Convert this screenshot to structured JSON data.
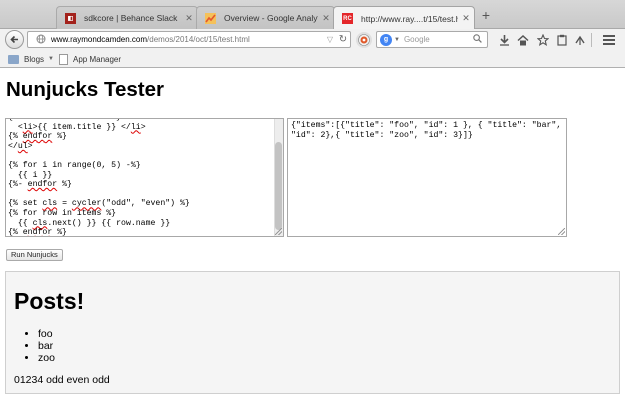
{
  "tabs": [
    {
      "label": "sdkcore | Behance Slack",
      "favicon": "behance-icon",
      "active": false
    },
    {
      "label": "Overview - Google Analytics",
      "favicon": "analytics-icon",
      "active": false
    },
    {
      "label": "http://www.ray....t/15/test.html",
      "favicon": "rc-icon",
      "favicon_text": "RC",
      "active": true
    }
  ],
  "new_tab_label": "+",
  "urlbar": {
    "url_domain": "www.raymondcamden.com",
    "url_path": "/demos/2014/oct/15/test.html"
  },
  "search": {
    "placeholder": "Google",
    "engine_icon": "g-icon"
  },
  "bookmarks": [
    {
      "label": "Blogs",
      "icon": "folder-icon",
      "has_dropdown": true
    },
    {
      "label": "App Manager",
      "icon": "page-icon",
      "has_dropdown": false
    }
  ],
  "page": {
    "title": "Nunjucks Tester",
    "template_code": "{% for item in items %}\n  <li>{{ item.title }} </li>\n{% endfor %}\n</ul>\n\n{% for i in range(0, 5) -%}\n  {{ i }}\n{%- endfor %}\n\n{% set cls = cycler(\"odd\", \"even\") %}\n{% for row in items %}\n  {{ cls.next() }} {{ row.name }}\n{% endfor %}",
    "json_data": "{\"items\":[{\"title\": \"foo\", \"id\": 1 }, { \"title\": \"bar\", \"id\": 2},{ \"title\": \"zoo\", \"id\": 3}]}",
    "run_button": "Run Nunjucks"
  },
  "result": {
    "heading": "Posts!",
    "items": [
      "foo",
      "bar",
      "zoo"
    ],
    "text": "01234 odd even odd"
  },
  "colors": {
    "rc_favicon": "#e4262a",
    "analytics_favicon": "#f1932a",
    "behance_favicon": "#a3221c"
  }
}
